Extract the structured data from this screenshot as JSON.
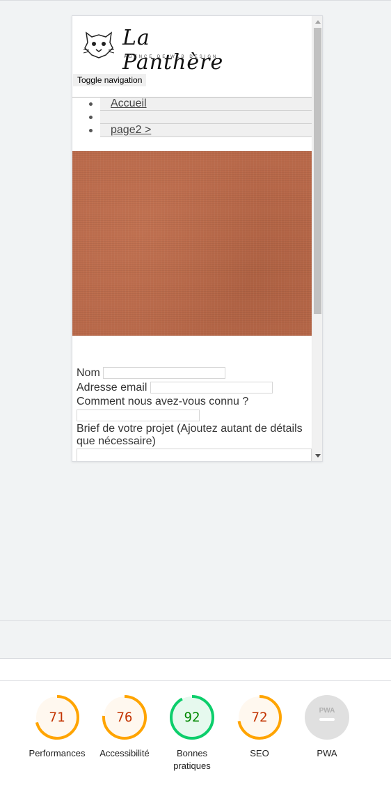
{
  "site": {
    "brand": "La Panthère",
    "tagline": "AGENCE DE WEB DESIGN",
    "toggle_label": "Toggle navigation",
    "menu": [
      {
        "label": "Accueil"
      },
      {
        "label": ""
      },
      {
        "label": "page2 >"
      }
    ],
    "hero_color": "#b9694a",
    "form": {
      "name_label": "Nom",
      "email_label": "Adresse email",
      "source_label": "Comment nous avez-vous connu ?",
      "brief_label_line1": "Brief de votre projet (Ajoutez autant de détails",
      "brief_label_line2": "que nécessaire)"
    }
  },
  "lighthouse": {
    "scores": [
      {
        "value": 71,
        "label": "Performances",
        "color": "#c33300",
        "ring": "#ffa400",
        "fill": "#fff8ef"
      },
      {
        "value": 76,
        "label": "Accessibilité",
        "color": "#c33300",
        "ring": "#ffa400",
        "fill": "#fff8ef"
      },
      {
        "value": 92,
        "label_line1": "Bonnes",
        "label_line2": "pratiques",
        "color": "#008800",
        "ring": "#0cce6b",
        "fill": "#e6f9ee"
      },
      {
        "value": 72,
        "label": "SEO",
        "color": "#c33300",
        "ring": "#ffa400",
        "fill": "#fff8ef"
      },
      {
        "label": "PWA",
        "icon": "pwa-badge-icon",
        "color": "#e0e0e0"
      }
    ]
  }
}
